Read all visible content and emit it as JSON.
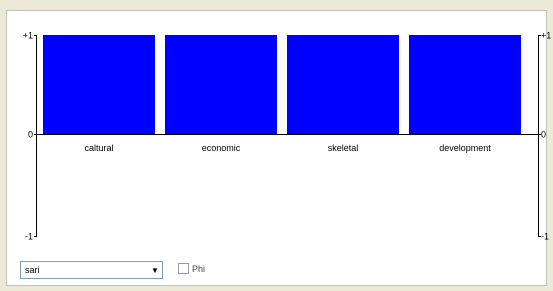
{
  "chart_data": {
    "type": "bar",
    "categories": [
      "caltural",
      "economic",
      "skeletal",
      "development"
    ],
    "values": [
      1,
      1,
      1,
      1
    ],
    "ylim": [
      -1,
      1
    ],
    "yticks": [
      "+1",
      "0",
      "-1"
    ],
    "bar_color": "#0000ff",
    "title": "",
    "xlabel": "",
    "ylabel": ""
  },
  "controls": {
    "dropdown_value": "sari",
    "checkbox_label": "Phi",
    "checkbox_checked": false
  }
}
